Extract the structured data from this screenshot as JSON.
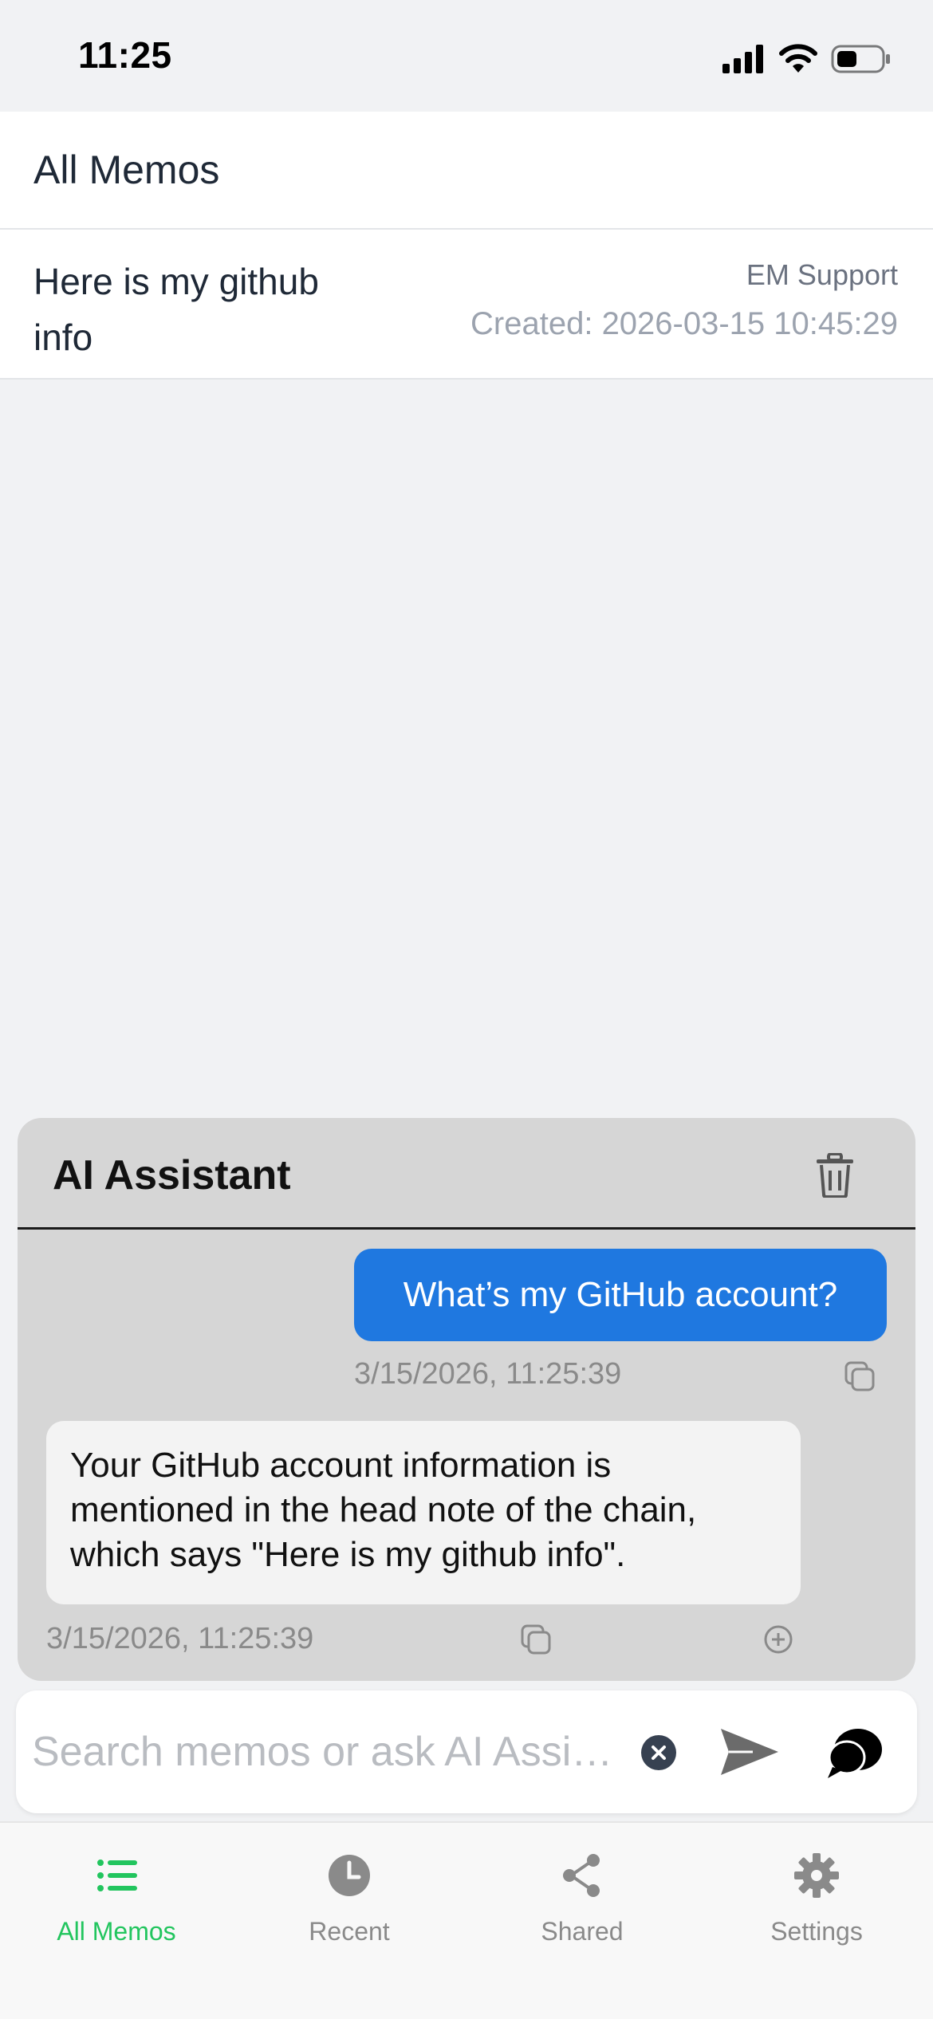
{
  "status_bar": {
    "time": "11:25"
  },
  "header": {
    "title": "All Memos"
  },
  "memos": [
    {
      "title": "Here is my github info",
      "tag": "EM Support",
      "created": "Created: 2026-03-15 10:45:29"
    }
  ],
  "ai_assistant": {
    "title": "AI Assistant",
    "messages": [
      {
        "role": "user",
        "text": "What’s  my GitHub account?",
        "time": "3/15/2026, 11:25:39"
      },
      {
        "role": "assistant",
        "text": "Your GitHub account information is mentioned in the head note of the chain, which says \"Here is my github info\".",
        "time": "3/15/2026, 11:25:39"
      }
    ]
  },
  "search": {
    "placeholder": "Search memos or ask AI Assi…",
    "value": ""
  },
  "tabs": [
    {
      "label": "All Memos",
      "icon": "list-icon",
      "active": true
    },
    {
      "label": "Recent",
      "icon": "clock-icon",
      "active": false
    },
    {
      "label": "Shared",
      "icon": "share-icon",
      "active": false
    },
    {
      "label": "Settings",
      "icon": "gear-icon",
      "active": false
    }
  ],
  "colors": {
    "accent": "#22c55e",
    "user_bubble": "#1f78e0",
    "panel": "#d6d6d6"
  }
}
